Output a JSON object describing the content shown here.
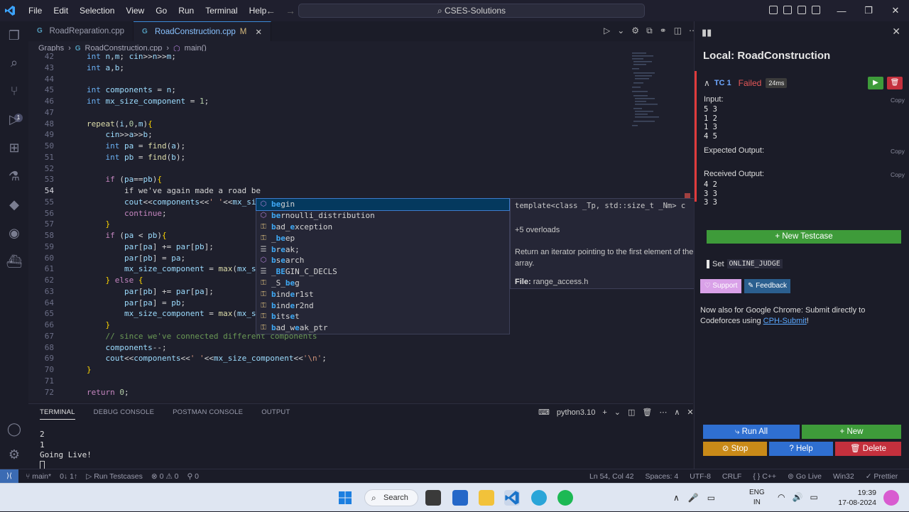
{
  "titlebar": {
    "menu": [
      "File",
      "Edit",
      "Selection",
      "View",
      "Go",
      "Run",
      "Terminal",
      "Help"
    ],
    "command_center": "CSES-Solutions"
  },
  "tabs": [
    {
      "label": "RoadReparation.cpp",
      "active": false
    },
    {
      "label": "RoadConstruction.cpp",
      "modified": "M",
      "active": true
    }
  ],
  "breadcrumb": {
    "folder": "Graphs",
    "file": "RoadConstruction.cpp",
    "symbol": "main()"
  },
  "editor": {
    "lines": [
      {
        "n": "42",
        "html": "<span class='ty'>int</span> <span class='vr'>n</span>,<span class='vr'>m</span>; <span class='vr'>cin</span>&gt;&gt;<span class='vr'>n</span>&gt;&gt;<span class='vr'>m</span>;"
      },
      {
        "n": "43",
        "html": "<span class='ty'>int</span> <span class='vr'>a</span>,<span class='vr'>b</span>;"
      },
      {
        "n": "44",
        "html": ""
      },
      {
        "n": "45",
        "html": "<span class='ty'>int</span> <span class='vr'>components</span> = <span class='vr'>n</span>;"
      },
      {
        "n": "46",
        "html": "<span class='ty'>int</span> <span class='vr'>mx_size_component</span> = <span class='nm'>1</span>;"
      },
      {
        "n": "47",
        "html": ""
      },
      {
        "n": "48",
        "html": "<span class='fn'>repeat</span>(<span class='vr'>i</span>,<span class='nm'>0</span>,<span class='vr'>m</span>)<span class='br'>{</span>"
      },
      {
        "n": "49",
        "html": "    <span class='vr'>cin</span>&gt;&gt;<span class='vr'>a</span>&gt;&gt;<span class='vr'>b</span>;"
      },
      {
        "n": "50",
        "html": "    <span class='ty'>int</span> <span class='vr'>pa</span> = <span class='fn'>find</span>(<span class='vr'>a</span>);"
      },
      {
        "n": "51",
        "html": "    <span class='ty'>int</span> <span class='vr'>pb</span> = <span class='fn'>find</span>(<span class='vr'>b</span>);"
      },
      {
        "n": "52",
        "html": ""
      },
      {
        "n": "53",
        "html": "    <span class='ct'>if</span> (<span class='vr'>pa</span>==<span class='vr'>pb</span>)<span class='br'>{</span>"
      },
      {
        "n": "54",
        "html": "        if we've again made a road be",
        "cur": true
      },
      {
        "n": "55",
        "html": "        <span class='vr'>cout</span>&lt;&lt;<span class='vr'>components</span>&lt;&lt;<span class='st'>' '</span>&lt;&lt;<span class='vr'>mx_siz</span>"
      },
      {
        "n": "56",
        "html": "        <span class='ct'>continue</span>;"
      },
      {
        "n": "57",
        "html": "    <span class='br'>}</span>"
      },
      {
        "n": "58",
        "html": "    <span class='ct'>if</span> (<span class='vr'>pa</span> &lt; <span class='vr'>pb</span>)<span class='br'>{</span>"
      },
      {
        "n": "59",
        "html": "        <span class='vr'>par</span>[<span class='vr'>pa</span>] += <span class='vr'>par</span>[<span class='vr'>pb</span>];"
      },
      {
        "n": "60",
        "html": "        <span class='vr'>par</span>[<span class='vr'>pb</span>] = <span class='vr'>pa</span>;"
      },
      {
        "n": "61",
        "html": "        <span class='vr'>mx_size_component</span> = <span class='fn'>max</span>(<span class='vr'>mx_si</span>"
      },
      {
        "n": "62",
        "html": "    <span class='br'>}</span> <span class='ct'>else</span> <span class='br'>{</span>"
      },
      {
        "n": "63",
        "html": "        <span class='vr'>par</span>[<span class='vr'>pb</span>] += <span class='vr'>par</span>[<span class='vr'>pa</span>];"
      },
      {
        "n": "64",
        "html": "        <span class='vr'>par</span>[<span class='vr'>pa</span>] = <span class='vr'>pb</span>;"
      },
      {
        "n": "65",
        "html": "        <span class='vr'>mx_size_component</span> = <span class='fn'>max</span>(<span class='vr'>mx_si</span>"
      },
      {
        "n": "66",
        "html": "    <span class='br'>}</span>"
      },
      {
        "n": "67",
        "html": "    <span class='cm'>// since we've connected different components</span>"
      },
      {
        "n": "68",
        "html": "    <span class='vr'>components</span>--;"
      },
      {
        "n": "69",
        "html": "    <span class='vr'>cout</span>&lt;&lt;<span class='vr'>components</span>&lt;&lt;<span class='st'>' '</span>&lt;&lt;<span class='vr'>mx_size_component</span>&lt;&lt;<span class='st'>'\\n'</span>;"
      },
      {
        "n": "70",
        "html": "<span class='br'>}</span>"
      },
      {
        "n": "71",
        "html": ""
      },
      {
        "n": "72",
        "html": "<span class='ct'>return</span> <span class='nm'>0</span>;"
      }
    ]
  },
  "suggestions": [
    {
      "match": "be",
      "rest": "gin",
      "kind": "cls",
      "selected": true
    },
    {
      "match": "be",
      "rest": "rnoulli_distribution",
      "kind": "cls"
    },
    {
      "match": "b",
      "mid": "ad_",
      "match2": "e",
      "rest": "xception",
      "kind": "fnc"
    },
    {
      "pre": "_",
      "match": "be",
      "rest": "ep",
      "kind": "fnc"
    },
    {
      "match": "b",
      "mid": "r",
      "match2": "e",
      "rest": "ak;",
      "kind": "kwd"
    },
    {
      "match": "b",
      "mid": "s",
      "match2": "e",
      "rest": "arch",
      "kind": "cls"
    },
    {
      "pre": "_",
      "match": "BE",
      "rest": "GIN_C_DECLS",
      "kind": "kwd"
    },
    {
      "pre": "_S_",
      "match": "be",
      "rest": "g",
      "kind": "fnc"
    },
    {
      "match": "b",
      "mid": "ind",
      "match2": "e",
      "rest": "r1st",
      "kind": "fnc"
    },
    {
      "match": "b",
      "mid": "ind",
      "match2": "e",
      "rest": "r2nd",
      "kind": "fnc"
    },
    {
      "match": "b",
      "mid": "its",
      "match2": "e",
      "rest": "t",
      "kind": "fnc"
    },
    {
      "match": "b",
      "mid": "ad_w",
      "match2": "e",
      "rest": "ak_ptr",
      "kind": "fnc"
    }
  ],
  "suggest_detail": {
    "signature": "template<class _Tp, std::size_t _Nm> c...",
    "overloads": "+5 overloads",
    "doc": "Return an iterator pointing to the first element of the array.",
    "file_label": "File:",
    "file": "range_access.h"
  },
  "panel": {
    "tabs": [
      "TERMINAL",
      "DEBUG CONSOLE",
      "POSTMAN CONSOLE",
      "OUTPUT"
    ],
    "shell": "python3.10",
    "output": [
      "2",
      "1",
      "Going Live!"
    ]
  },
  "status": {
    "branch": "main*",
    "sync": "0↓ 1↑",
    "run_testcases": "Run Testcases",
    "problems": "⊗ 0 ⚠ 0",
    "ports": "⚲ 0",
    "position": "Ln 54, Col 42",
    "spaces": "Spaces: 4",
    "encoding": "UTF-8",
    "eol": "CRLF",
    "language": "{ } C++",
    "go_live": "Go Live",
    "platform": "Win32",
    "prettier": "✓ Prettier"
  },
  "cph": {
    "title": "Local: RoadConstruction",
    "testcase": {
      "name": "TC 1",
      "verdict": "Failed",
      "time": "24ms",
      "input_label": "Input:",
      "input": "5 3\n1 2\n1 3\n4 5",
      "expected_label": "Expected Output:",
      "expected": "",
      "received_label": "Received Output:",
      "received": "4 2\n3 3\n3 3",
      "copy": "Copy"
    },
    "new_testcase": "+ New Testcase",
    "set_label": "Set",
    "online_judge": "ONLINE_JUDGE",
    "support": "Support",
    "feedback": "Feedback",
    "note_prefix": "Now also for Google Chrome: Submit directly to Codeforces using ",
    "note_link": "CPH-Submit",
    "note_suffix": "!",
    "buttons": {
      "run_all": "Run All",
      "new": "+ New",
      "stop": "Stop",
      "help": "Help",
      "delete": "Delete"
    },
    "colors": {
      "blue": "#2f6fd1",
      "green": "#3e9b3a",
      "orange": "#c98a18",
      "red": "#c4303d",
      "failed": "#e03b3b"
    }
  },
  "taskbar": {
    "search": "Search",
    "lang_top": "ENG",
    "lang_bottom": "IN",
    "time": "19:39",
    "date": "17-08-2024"
  }
}
